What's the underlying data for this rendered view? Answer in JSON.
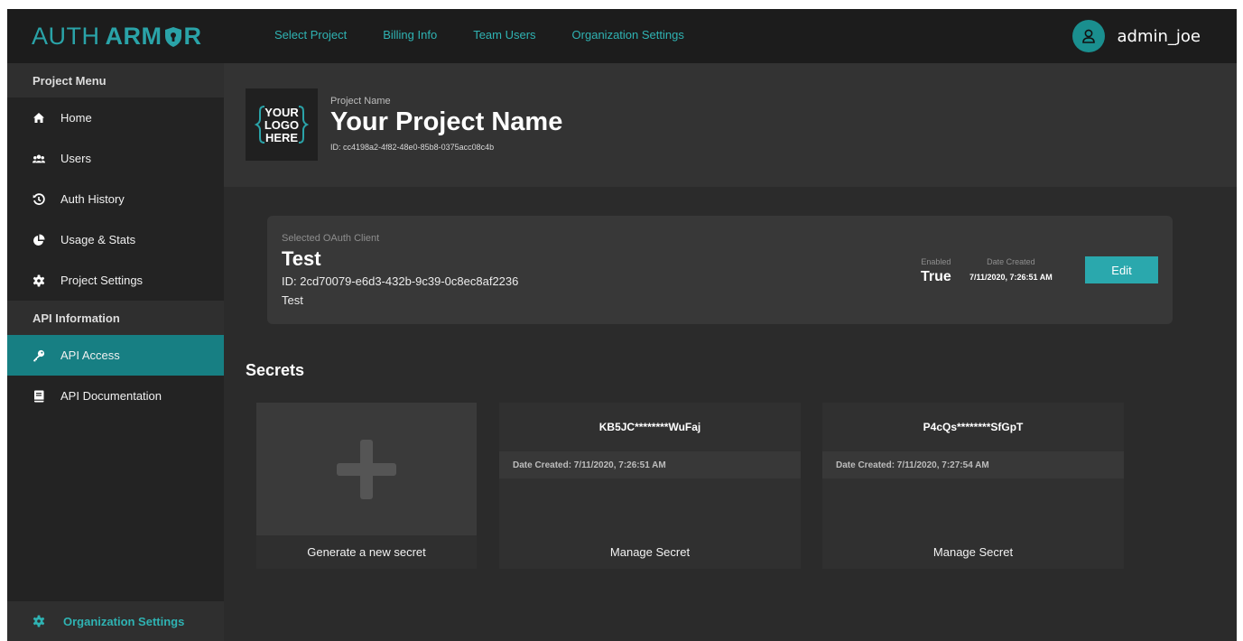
{
  "brand": {
    "part1": "AUTH",
    "part2a": "ARM",
    "part2b": "R"
  },
  "nav": [
    "Select Project",
    "Billing Info",
    "Team Users",
    "Organization Settings"
  ],
  "user": {
    "name": "admin_joe",
    "avatar_icon": "user-icon"
  },
  "sidebar": {
    "section1": "Project Menu",
    "items1": [
      {
        "label": "Home",
        "icon": "home-icon"
      },
      {
        "label": "Users",
        "icon": "users-icon"
      },
      {
        "label": "Auth History",
        "icon": "history-icon"
      },
      {
        "label": "Usage & Stats",
        "icon": "pie-chart-icon"
      },
      {
        "label": "Project Settings",
        "icon": "gear-icon"
      }
    ],
    "section2": "API Information",
    "items2": [
      {
        "label": "API Access",
        "icon": "key-icon",
        "active": true
      },
      {
        "label": "API Documentation",
        "icon": "book-icon"
      }
    ],
    "bottom": {
      "label": "Organization Settings",
      "icon": "gear-icon"
    }
  },
  "project": {
    "logo_lines": [
      "YOUR",
      "LOGO",
      "HERE"
    ],
    "label": "Project Name",
    "name": "Your Project Name",
    "id": "ID: cc4198a2-4f82-48e0-85b8-0375acc08c4b"
  },
  "oauth": {
    "label": "Selected OAuth Client",
    "name": "Test",
    "id": "ID: 2cd70079-e6d3-432b-9c39-0c8ec8af2236",
    "description": "Test",
    "enabled_label": "Enabled",
    "enabled_value": "True",
    "date_label": "Date Created",
    "date_value": "7/11/2020, 7:26:51 AM",
    "edit": "Edit"
  },
  "secrets": {
    "title": "Secrets",
    "generate": "Generate a new secret",
    "items": [
      {
        "key": "KB5JC********WuFaj",
        "date": "Date Created: 7/11/2020, 7:26:51 AM",
        "action": "Manage Secret"
      },
      {
        "key": "P4cQs********SfGpT",
        "date": "Date Created: 7/11/2020, 7:27:54 AM",
        "action": "Manage Secret"
      }
    ]
  },
  "colors": {
    "accent": "#2aa8ad",
    "active_bg": "#177f83",
    "nav_text": "#2fb3b3"
  }
}
